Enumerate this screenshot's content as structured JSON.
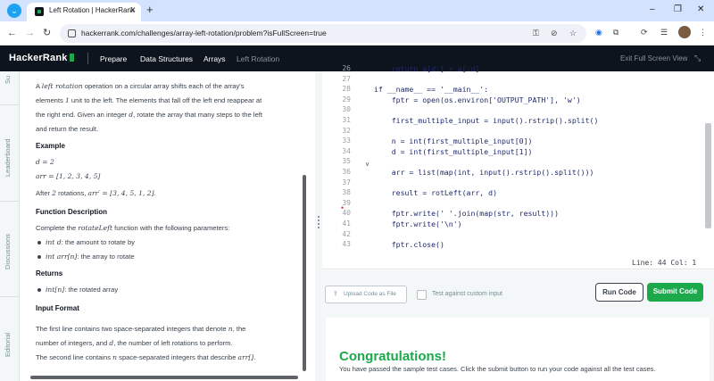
{
  "browser": {
    "tab_title": "Left Rotation | HackerRank",
    "tab_close": "✕",
    "new_tab": "+",
    "url": "hackerrank.com/challenges/array-left-rotation/problem?isFullScreen=true",
    "window_controls": [
      "–",
      "❐",
      "✕"
    ],
    "nav": {
      "back": "←",
      "forward": "→",
      "reload": "↻"
    }
  },
  "header": {
    "logo": "HackerRank",
    "breadcrumbs": [
      "Prepare",
      "Data Structures",
      "Arrays",
      "Left Rotation"
    ],
    "exit_fullscreen": "Exit Full Screen View"
  },
  "side_tabs": [
    "Su",
    "Leaderboard",
    "Discussions",
    "Editorial"
  ],
  "problem": {
    "intro_1_a": "A ",
    "intro_1_math": "left rotation",
    "intro_1_b": " operation on a circular array shifts each of the array's",
    "intro_2_a": "elements ",
    "intro_2_math": "1",
    "intro_2_b": " unit to the left. The elements that fall off the left end reappear at",
    "intro_3": "the right end. Given an integer ",
    "intro_3_math": "d",
    "intro_3_b": ", rotate the array that many steps to the left",
    "intro_4": "and return the result.",
    "example_heading": "Example",
    "example_d": "d = 2",
    "example_arr": "arr = [1, 2, 3, 4, 5]",
    "after_a": "After ",
    "after_math1": "2",
    "after_b": " rotations, ",
    "after_math2": "arr′ = [3, 4, 5, 1, 2]",
    "after_c": ".",
    "function_heading": "Function Description",
    "complete_a": "Complete the ",
    "complete_math": "rotateLeft",
    "complete_b": " function with the following parameters:",
    "param1_math": "int d",
    "param1_text": ": the amount to rotate by",
    "param2_math": "int arr[n]",
    "param2_text": ": the array to rotate",
    "returns_heading": "Returns",
    "return1_math": "int[n]",
    "return1_text": ": the rotated array",
    "input_heading": "Input Format",
    "input_1_a": "The first line contains two space-separated integers that denote ",
    "input_1_math": "n",
    "input_1_b": ", the",
    "input_2_a": "number of integers, and ",
    "input_2_math": "d",
    "input_2_b": ", the number of left rotations to perform.",
    "input_3_a": "The second line contains ",
    "input_3_math": "n",
    "input_3_b": " space-separated integers that describe ",
    "input_3_math2": "arr[]",
    "input_3_c": "."
  },
  "editor": {
    "lines": [
      {
        "n": "26",
        "code": "    return a[d:] + a[:d]"
      },
      {
        "n": "27",
        "code": ""
      },
      {
        "n": "28",
        "code": "if __name__ == '__main__':"
      },
      {
        "n": "29",
        "code": "    fptr = open(os.environ['OUTPUT_PATH'], 'w')"
      },
      {
        "n": "30",
        "code": ""
      },
      {
        "n": "31",
        "code": "    first_multiple_input = input().rstrip().split()"
      },
      {
        "n": "32",
        "code": ""
      },
      {
        "n": "33",
        "code": "    n = int(first_multiple_input[0])"
      },
      {
        "n": "34",
        "code": "    d = int(first_multiple_input[1])"
      },
      {
        "n": "35",
        "code": ""
      },
      {
        "n": "36",
        "code": "    arr = list(map(int, input().rstrip().split()))"
      },
      {
        "n": "37",
        "code": ""
      },
      {
        "n": "38",
        "code": "    result = rotLeft(arr, d)"
      },
      {
        "n": "39",
        "code": ""
      },
      {
        "n": "40",
        "code": "    fptr.write(' '.join(map(str, result)))"
      },
      {
        "n": "41",
        "code": "    fptr.write('\\n')"
      },
      {
        "n": "42",
        "code": ""
      },
      {
        "n": "43",
        "code": "    fptr.close()"
      }
    ],
    "fold_marker": "∨",
    "error_marker": "•",
    "status": "Line: 44 Col: 1"
  },
  "actions": {
    "upload_label": "Upload Code as File",
    "custom_input_label": "Test against custom input",
    "run_label": "Run Code",
    "submit_label": "Submit Code"
  },
  "result": {
    "title": "Congratulations!",
    "message": "You have passed the sample test cases. Click the submit button to run your code against all the test cases."
  }
}
